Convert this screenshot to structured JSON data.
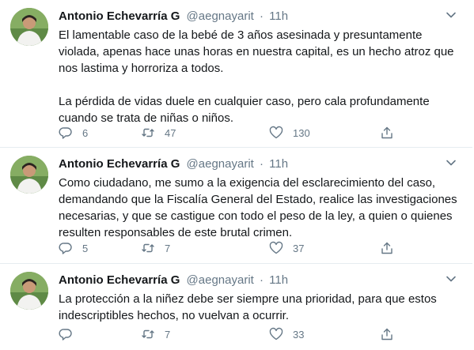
{
  "tweets": [
    {
      "name": "Antonio Echevarría G",
      "handle": "@aegnayarit",
      "separator": "·",
      "time": "11h",
      "text": "El lamentable caso de la bebé de 3 años asesinada y presuntamente violada, apenas hace unas horas en nuestra capital, es un hecho atroz que nos lastima y horroriza a todos.\n\nLa pérdida de vidas duele en cualquier caso, pero cala profundamente cuando se trata de niñas o niños.",
      "replies": "6",
      "retweets": "47",
      "likes": "130"
    },
    {
      "name": "Antonio Echevarría G",
      "handle": "@aegnayarit",
      "separator": "·",
      "time": "11h",
      "text": "Como ciudadano, me sumo a la exigencia del esclarecimiento del caso, demandando que la Fiscalía General del Estado, realice las investigaciones necesarias, y que se castigue con todo el peso de la ley, a quien o quienes resulten responsables de este brutal crimen.",
      "replies": "5",
      "retweets": "7",
      "likes": "37"
    },
    {
      "name": "Antonio Echevarría G",
      "handle": "@aegnayarit",
      "separator": "·",
      "time": "11h",
      "text": "La protección a la niñez debe ser siempre una prioridad, para que estos indescriptibles hechos, no vuelvan a ocurrir.",
      "replies": "",
      "retweets": "7",
      "likes": "33"
    }
  ],
  "icons": {
    "reply": "reply-icon",
    "retweet": "retweet-icon",
    "like": "heart-icon",
    "share": "share-icon",
    "more": "chevron-down-icon"
  },
  "colors": {
    "text": "#14171a",
    "secondary": "#657786",
    "divider": "#e6ecf0"
  }
}
